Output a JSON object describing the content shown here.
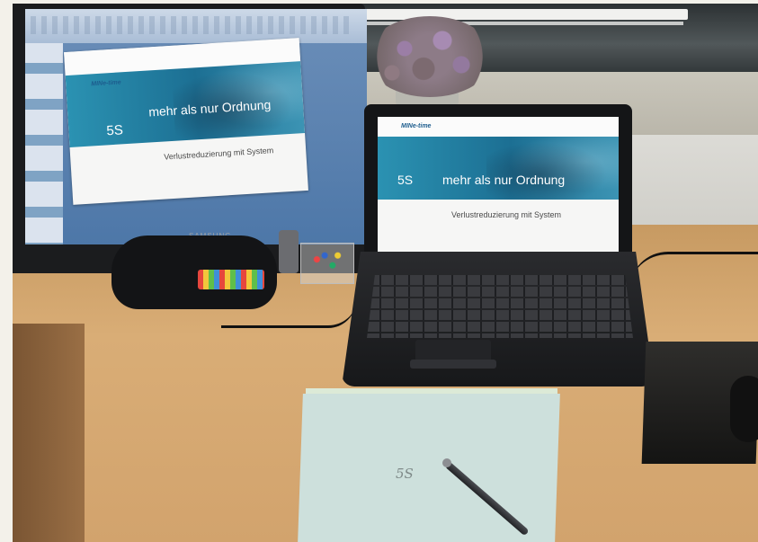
{
  "photo": {
    "monitor": {
      "brand": "SAMSUNG",
      "slide": {
        "logo": "MINe-time",
        "label_5s": "5S",
        "title": "mehr als nur Ordnung",
        "subtitle": "Verlustreduzierung mit System"
      }
    },
    "laptop": {
      "slide": {
        "logo": "MINe-time",
        "label_5s": "5S",
        "title": "mehr als nur Ordnung",
        "subtitle": "Verlustreduzierung mit System"
      }
    },
    "paper": {
      "handwriting": "5S"
    }
  }
}
